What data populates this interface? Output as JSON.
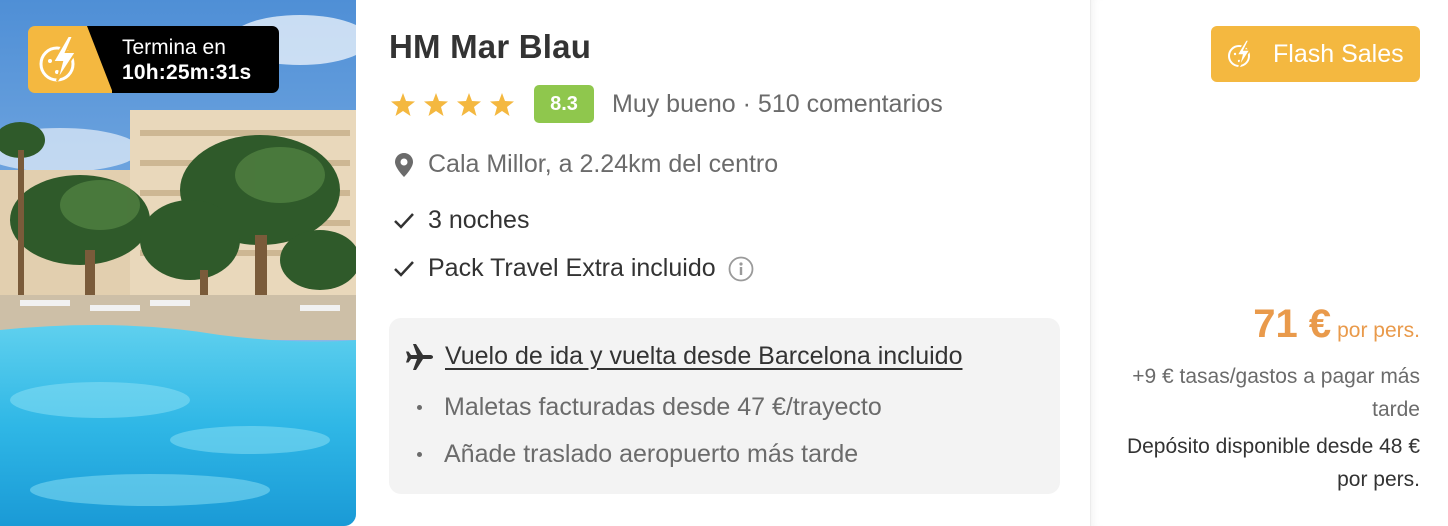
{
  "image": {
    "alt": "hotel-pool-photo",
    "timer": {
      "icon": "flash-bolt-icon",
      "label": "Termina en",
      "value": "10h:25m:31s"
    }
  },
  "hotel": {
    "name": "HM Mar Blau",
    "stars": 4,
    "score": "8.3",
    "rating_label": "Muy bueno · 510 comentarios",
    "location": "Cala Millor, a 2.24km del centro",
    "features": [
      "3 noches",
      "Pack Travel Extra incluido"
    ]
  },
  "flight": {
    "headline": "Vuelo de ida y vuelta desde Barcelona incluido",
    "items": [
      "Maletas facturadas desde 47 €/trayecto",
      "Añade traslado aeropuerto más tarde"
    ]
  },
  "pricing": {
    "badge": "Flash Sales",
    "amount": "71 €",
    "unit": "por pers.",
    "taxes": "+9 € tasas/gastos a pagar más tarde",
    "deposit": "Depósito disponible desde 48 € por pers."
  },
  "colors": {
    "flash": "#f4b840",
    "score": "#8fc74d",
    "price": "#e99a4b",
    "star": "#f4b840"
  }
}
